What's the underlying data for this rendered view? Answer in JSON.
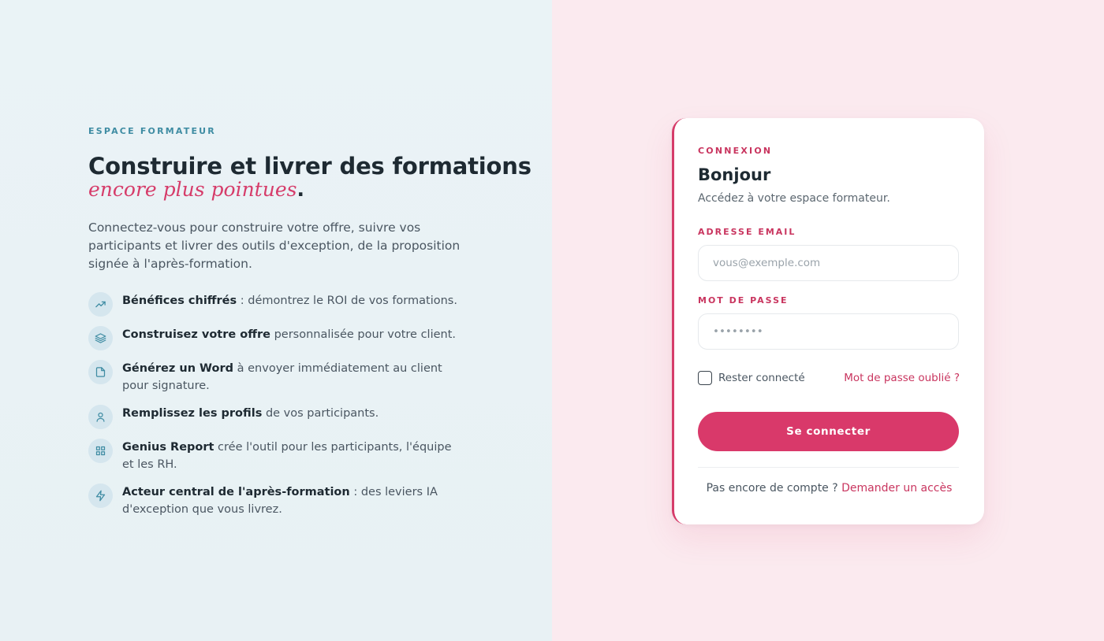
{
  "hero": {
    "eyebrow": "ESPACE FORMATEUR",
    "headline": "Construire et livrer des formations",
    "subline": "encore plus pointues",
    "subline_dot": ".",
    "intro": "Connectez-vous pour construire votre offre, suivre vos participants et livrer des outils d'exception, de la proposition signée à l'après-formation."
  },
  "features": [
    {
      "icon": "trending-up-icon",
      "bold": "Bénéfices chiffrés",
      "text": " : démontrez le ROI de vos formations."
    },
    {
      "icon": "layers-icon",
      "bold": "Construisez votre offre",
      "text": " personnalisée pour votre client."
    },
    {
      "icon": "document-icon",
      "bold": "Générez un Word",
      "text": " à envoyer immédiatement au client pour signature."
    },
    {
      "icon": "user-icon",
      "bold": "Remplissez les profils",
      "text": " de vos participants."
    },
    {
      "icon": "grid-icon",
      "bold": "Genius Report",
      "text": " crée l'outil pour les participants, l'équipe et les RH."
    },
    {
      "icon": "lightning-icon",
      "bold": "Acteur central de l'après-formation",
      "text": " : des leviers IA d'exception que vous livrez."
    }
  ],
  "login": {
    "eyebrow": "CONNEXION",
    "title": "Bonjour",
    "subtitle": "Accédez à votre espace formateur.",
    "email_label": "ADRESSE EMAIL",
    "email_placeholder": "vous@exemple.com",
    "email_value": "",
    "password_label": "MOT DE PASSE",
    "password_placeholder": "••••••••",
    "password_value": "",
    "remember_label": "Rester connecté",
    "remember_checked": false,
    "forgot_label": "Mot de passe oublié ?",
    "submit_label": "Se connecter",
    "signup_text": "Pas encore de compte ? ",
    "signup_link": "Demander un accès"
  },
  "colors": {
    "accent": "#d9396a",
    "accent_text": "#c9355f",
    "teal": "#3f8ca3",
    "left_bg": "#eaf3f6",
    "right_bg": "#fbeaef"
  }
}
